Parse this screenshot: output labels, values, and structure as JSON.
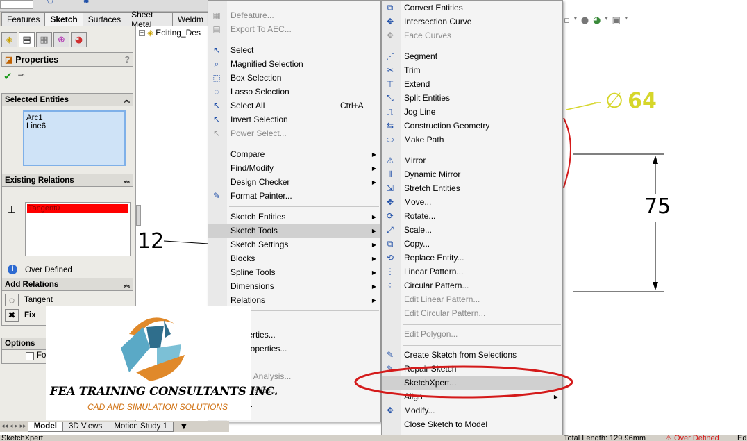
{
  "tabs": [
    "Features",
    "Sketch",
    "Surfaces",
    "Sheet Metal",
    "Weldm"
  ],
  "active_tab": "Sketch",
  "tree": {
    "item": "Editing_Des"
  },
  "property_manager": {
    "title": "Properties",
    "help": "?",
    "selected_entities": {
      "header": "Selected Entities",
      "items": [
        "Arc1",
        "Line6"
      ]
    },
    "existing_relations": {
      "header": "Existing Relations",
      "items": [
        "Tangent0"
      ],
      "status": "Over Defined"
    },
    "add_relations": {
      "header": "Add Relations",
      "items": [
        "Tangent",
        "Fix"
      ]
    },
    "options": {
      "header": "Options",
      "checkbox_label": "Fo"
    }
  },
  "canvas": {
    "dim_diameter": "64",
    "dim_vertical": "75",
    "dim_left": "12"
  },
  "bottom_tabs": [
    "Model",
    "3D Views",
    "Motion Study 1"
  ],
  "status_bar": {
    "left": "SketchXpert",
    "length": "Total Length: 129.96mm",
    "state": "Over Defined",
    "far_right": "Ed"
  },
  "logo": {
    "line1": "FEA TRAINING  CONSULTANTS INC.",
    "line2": "CAD AND SIMULATION SOLUTIONS"
  },
  "menu_left": {
    "items": [
      {
        "label": "Defeature...",
        "disabled": true,
        "icon": "defeature-icon"
      },
      {
        "label": "Export To AEC...",
        "disabled": true,
        "icon": "aec-icon"
      },
      {
        "label": "Select",
        "icon": "select-icon"
      },
      {
        "label": "Magnified Selection",
        "icon": "magnify-icon"
      },
      {
        "label": "Box Selection",
        "icon": "box-select-icon"
      },
      {
        "label": "Lasso Selection",
        "icon": "lasso-icon"
      },
      {
        "label": "Select All",
        "shortcut": "Ctrl+A",
        "icon": "select-all-icon"
      },
      {
        "label": "Invert Selection",
        "icon": "invert-icon"
      },
      {
        "label": "Power Select...",
        "disabled": true,
        "icon": "power-select-icon"
      },
      {
        "label": "Compare",
        "submenu": true
      },
      {
        "label": "Find/Modify",
        "submenu": true
      },
      {
        "label": "Design Checker",
        "submenu": true
      },
      {
        "label": "Format Painter...",
        "icon": "format-painter-icon"
      },
      {
        "label": "Sketch Entities",
        "submenu": true
      },
      {
        "label": "Sketch Tools",
        "submenu": true,
        "highlight": true
      },
      {
        "label": "Sketch Settings",
        "submenu": true
      },
      {
        "label": "Blocks",
        "submenu": true
      },
      {
        "label": "Spline Tools",
        "submenu": true
      },
      {
        "label": "Dimensions",
        "submenu": true
      },
      {
        "label": "Relations",
        "submenu": true
      },
      {
        "label": "ure..."
      },
      {
        "label": "Properties..."
      },
      {
        "label": "on Properties..."
      },
      {
        "label": "k..."
      },
      {
        "label": "metry Analysis...",
        "disabled": true
      },
      {
        "label": "e Statistics...",
        "disabled": true
      },
      {
        "label": "ions..."
      }
    ]
  },
  "menu_right": {
    "items": [
      {
        "label": "Convert Entities",
        "icon": "convert-icon"
      },
      {
        "label": "Intersection Curve",
        "icon": "intersection-icon"
      },
      {
        "label": "Face Curves",
        "disabled": true,
        "icon": "face-curves-icon"
      },
      {
        "label": "Segment",
        "icon": "segment-icon"
      },
      {
        "label": "Trim",
        "icon": "trim-icon"
      },
      {
        "label": "Extend",
        "icon": "extend-icon"
      },
      {
        "label": "Split Entities",
        "icon": "split-icon"
      },
      {
        "label": "Jog Line",
        "icon": "jog-icon"
      },
      {
        "label": "Construction Geometry",
        "icon": "construction-icon"
      },
      {
        "label": "Make Path",
        "icon": "path-icon"
      },
      {
        "label": "Mirror",
        "icon": "mirror-icon"
      },
      {
        "label": "Dynamic Mirror",
        "icon": "dynamic-mirror-icon"
      },
      {
        "label": "Stretch Entities",
        "icon": "stretch-icon"
      },
      {
        "label": "Move...",
        "icon": "move-icon"
      },
      {
        "label": "Rotate...",
        "icon": "rotate-icon"
      },
      {
        "label": "Scale...",
        "icon": "scale-icon"
      },
      {
        "label": "Copy...",
        "icon": "copy-icon"
      },
      {
        "label": "Replace Entity...",
        "icon": "replace-icon"
      },
      {
        "label": "Linear Pattern...",
        "icon": "linear-pattern-icon"
      },
      {
        "label": "Circular Pattern...",
        "icon": "circular-pattern-icon"
      },
      {
        "label": "Edit Linear Pattern...",
        "disabled": true
      },
      {
        "label": "Edit Circular Pattern...",
        "disabled": true
      },
      {
        "label": "Edit Polygon...",
        "disabled": true
      },
      {
        "label": "Create Sketch from Selections",
        "icon": "create-sketch-icon"
      },
      {
        "label": "Repair Sketch",
        "icon": "repair-icon"
      },
      {
        "label": "SketchXpert...",
        "highlight": true
      },
      {
        "label": "Align",
        "submenu": true
      },
      {
        "label": "Modify...",
        "icon": "modify-icon"
      },
      {
        "label": "Close Sketch to Model"
      },
      {
        "label": "Check Sketch for Feature..."
      }
    ]
  },
  "colors": {
    "highlight_ellipse": "#d41a1a",
    "dim_yellow": "#d6d62a",
    "relation_red": "#ff0000"
  }
}
